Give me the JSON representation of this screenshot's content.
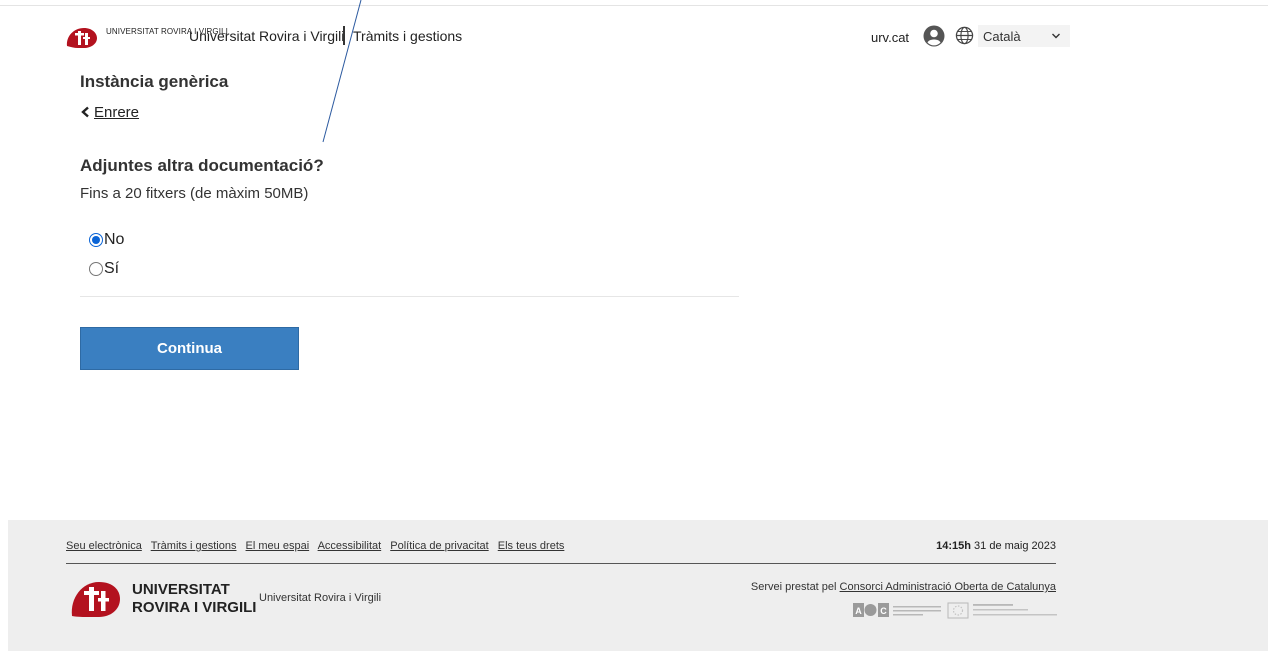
{
  "header": {
    "logo_text": "Universitat Rovira i Virgili",
    "title": "Universitat Rovira i Virgili",
    "section": "Tràmits i gestions",
    "site_link": "urv.cat",
    "language": "Català"
  },
  "main": {
    "page_title": "Instància genèrica",
    "back_label": "Enrere",
    "question": "Adjuntes altra documentació?",
    "hint": "Fins a 20 fitxers (de màxim 50MB)",
    "options": [
      {
        "label": "No",
        "checked": true
      },
      {
        "label": "Sí",
        "checked": false
      }
    ],
    "continue_label": "Continua"
  },
  "footer": {
    "links": [
      "Seu electrònica",
      "Tràmits i gestions",
      "El meu espai",
      "Accessibilitat",
      "Política de privacitat",
      "Els teus drets"
    ],
    "time": "14:15h",
    "date": "31 de maig 2023",
    "university_name": "Universitat Rovira i Virgili",
    "university_small": "Universitat Rovira i Virgili",
    "service_prefix": "Servei prestat pel",
    "service_link": "Consorci Administració Oberta de Catalunya",
    "badge_aoc": "AOC",
    "badge_aoc_text": "Consorci Administració Oberta de Catalunya",
    "badge_eu_text": "Unió Europea Fons Europeu de Desenvolupament Regional"
  },
  "colors": {
    "primary_button": "#3a7fc1",
    "radio_accent": "#0a64d6",
    "brand_red": "#b3121f",
    "footer_bg": "#eeeeee"
  }
}
